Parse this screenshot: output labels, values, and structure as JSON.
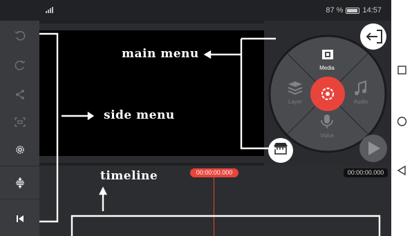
{
  "status_bar": {
    "battery_text": "87 %",
    "time": "14:57"
  },
  "annotations": {
    "main_menu": "main menu",
    "side_menu": "side menu",
    "timeline": "timeline"
  },
  "side_menu": {
    "items": [
      {
        "icon": "undo-icon"
      },
      {
        "icon": "redo-icon"
      },
      {
        "icon": "share-icon"
      },
      {
        "icon": "capture-icon"
      },
      {
        "icon": "settings-icon"
      },
      {
        "icon": "timeline-expand-icon"
      },
      {
        "icon": "skip-to-start-icon"
      }
    ]
  },
  "main_menu": {
    "items": [
      {
        "label": "Media",
        "icon": "media-icon"
      },
      {
        "label": "Layer",
        "icon": "layer-icon"
      },
      {
        "label": "Audio",
        "icon": "audio-icon"
      },
      {
        "label": "Voice",
        "icon": "voice-icon"
      }
    ],
    "center_icon": "camera-icon",
    "accent": "#e8443b"
  },
  "timeline": {
    "current_time": "00:00:00.000",
    "total_time": "00:00:00.000"
  },
  "colors": {
    "accent": "#e8443b",
    "background": "#1f2022",
    "sidebar": "#3a3b3e"
  }
}
